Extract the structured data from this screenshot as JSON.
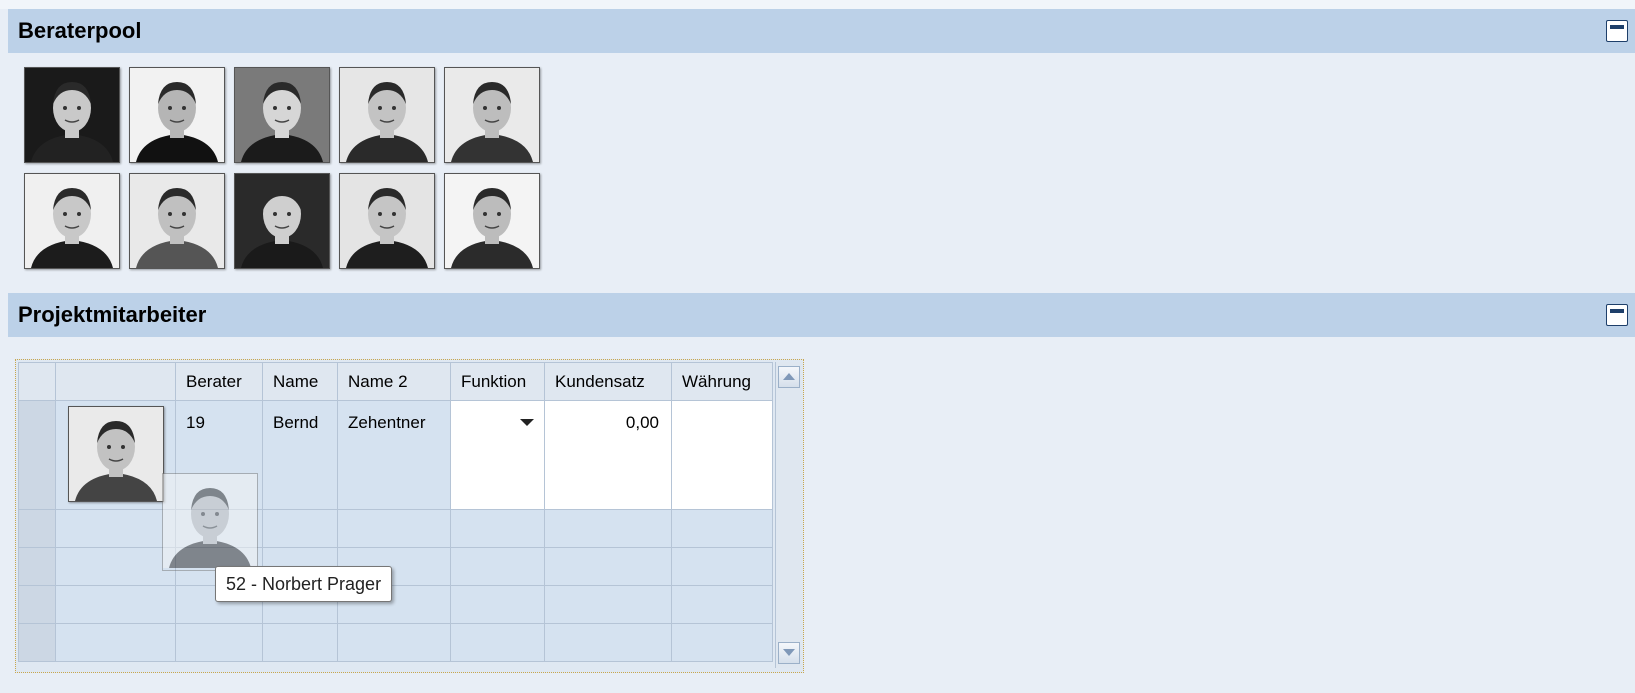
{
  "berater_panel": {
    "title": "Beraterpool",
    "photos": [
      {
        "name": "consultant-photo-1"
      },
      {
        "name": "consultant-photo-2"
      },
      {
        "name": "consultant-photo-3"
      },
      {
        "name": "consultant-photo-4"
      },
      {
        "name": "consultant-photo-5"
      },
      {
        "name": "consultant-photo-6"
      },
      {
        "name": "consultant-photo-7"
      },
      {
        "name": "consultant-photo-8"
      },
      {
        "name": "consultant-photo-9"
      },
      {
        "name": "consultant-photo-10"
      }
    ]
  },
  "projekt_panel": {
    "title": "Projektmitarbeiter",
    "columns": [
      "Berater",
      "Name",
      "Name 2",
      "Funktion",
      "Kundensatz",
      "Währung"
    ],
    "rows": [
      {
        "berater": "19",
        "name": "Bernd",
        "name2": "Zehentner",
        "funktion": "",
        "kundensatz": "0,00",
        "waehrung": ""
      }
    ]
  },
  "drag": {
    "tooltip": "52 - Norbert Prager"
  },
  "colors": {
    "header_bg": "#bcd1e8",
    "page_bg": "#e8eef6",
    "table_cell": "#d5e2f0"
  }
}
